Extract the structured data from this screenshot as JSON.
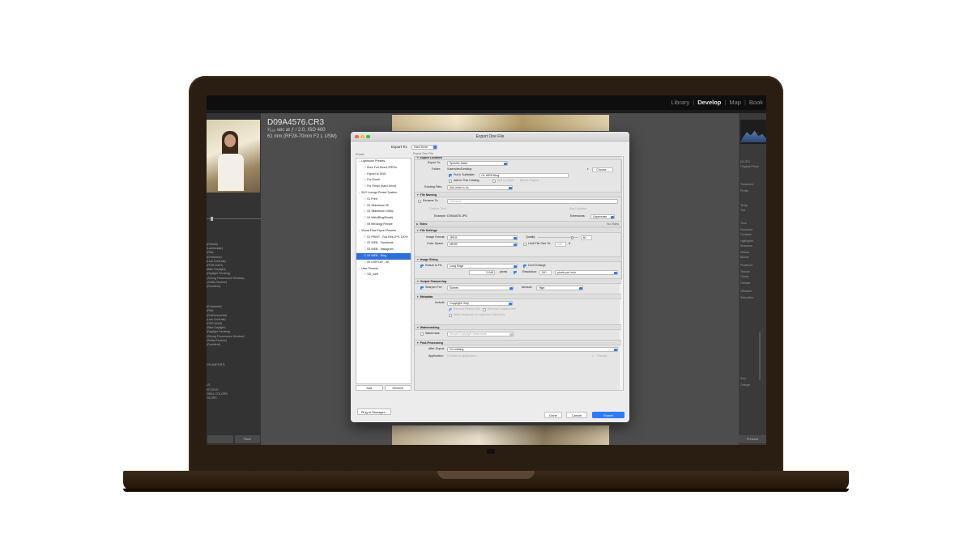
{
  "lightroom": {
    "modules": [
      "Library",
      "Develop",
      "Map",
      "Book"
    ],
    "active_module": "Develop",
    "image_info": {
      "filename": "D09A4576.CR3",
      "exposure": "¹⁄₃₂₀ sec at ƒ / 2.0, ISO 400",
      "lens": "61 mm (RF28-70mm F2 L USM)"
    },
    "left_footer": [
      "",
      "Paste"
    ],
    "right_footer": "Previous",
    "right_panel_texts": [
      "D0 ISO",
      "Original Photo",
      "Treatment",
      "Profile",
      "Temp",
      "Tint",
      "Tone",
      "Exposure",
      "Contrast",
      "Highlights",
      "Shadows",
      "Whites",
      "Blacks",
      "Presence",
      "Texture",
      "Clarity",
      "Dehaze",
      "Vibrance",
      "Saturation",
      "Red",
      "Orange"
    ],
    "left_panel_items": [
      "(Default)",
      "(Landscape)",
      "(Flat)",
      "(Enhanced)",
      "(Low Contrast)",
      "(FISH 400H)",
      "(Blue Daylight)",
      "(Daylight Sensing)",
      "(Strong Fluorescent Window)",
      "(Softis Restore)",
      "(Excellent)",
      "",
      "(Enhanced)",
      "(Flat)",
      "(Environmental)",
      "(Low Contrast)",
      "(DFR 400H)",
      "(Blue Daylight)",
      "(Daylight Sensing)",
      "(Strong Fluorescent Window)",
      "(Softis Restore)",
      "(Excellent)",
      "",
      "OS (IMPORT)",
      "",
      "LS",
      "ISTUDIO",
      "ORAL COLORS",
      "OLORS"
    ]
  },
  "dialog": {
    "title": "Export One File",
    "export_to_label": "Export To:",
    "export_to_value": "Hard Drive",
    "export_one_file": "Export One File",
    "preset_label": "Preset:",
    "presets": [
      {
        "type": "folder",
        "label": "Lightroom Presets"
      },
      {
        "type": "item",
        "label": "Burn Full-Sized JPEGs"
      },
      {
        "type": "item",
        "label": "Export to DNG"
      },
      {
        "type": "item",
        "label": "For Email"
      },
      {
        "type": "item",
        "label": "For Email (Hard Drive)"
      },
      {
        "type": "folder",
        "label": "SLR Lounge Preset System"
      },
      {
        "type": "item",
        "label": "01 Print"
      },
      {
        "type": "item",
        "label": "02 Slideshow 4K"
      },
      {
        "type": "item",
        "label": "03 Slideshow 1080p"
      },
      {
        "type": "item",
        "label": "04 Web(Blog/Email)"
      },
      {
        "type": "item",
        "label": "05 Mixology Recipe"
      },
      {
        "type": "folder",
        "label": "Visual Flow Export Presets"
      },
      {
        "type": "item",
        "label": "01 PRINT - Full-Res JPG 100%"
      },
      {
        "type": "item",
        "label": "02 WEB - Facebook"
      },
      {
        "type": "item",
        "label": "03 WEB - Instagram"
      },
      {
        "type": "item",
        "label": "04 WEB - Blog",
        "selected": true
      },
      {
        "type": "item",
        "label": "05 DISPLAY - 4K"
      },
      {
        "type": "folder",
        "label": "User Presets"
      },
      {
        "type": "item",
        "label": "SD_web"
      }
    ],
    "add_button": "Add",
    "remove_button": "Remove",
    "plugin_manager_button": "Plug-in Manager...",
    "done_button": "Done",
    "cancel_button": "Cancel",
    "export_button": "Export",
    "location": {
      "header": "Export Location",
      "export_to_label": "Export To:",
      "export_to_value": "Specific folder",
      "folder_label": "Folder:",
      "folder_value": "/Users/dm/Desktop",
      "choose_button": "Choose...",
      "subfolder_label": "Put in Subfolder:",
      "subfolder_value": "04-WEB-Blog",
      "add_catalog_label": "Add to This Catalog",
      "add_stack_label": "Add to Stack:",
      "add_stack_value": "Below Original",
      "existing_files_label": "Existing Files:",
      "existing_files_value": "Ask what to do"
    },
    "naming": {
      "header": "File Naming",
      "rename_label": "Rename To:",
      "rename_value": "Filename",
      "custom_text_label": "Custom Text:",
      "start_number_label": "Start Number:",
      "example_label": "Example:",
      "example_value": "D09A4576.JPG",
      "extensions_label": "Extensions:",
      "extensions_value": "Uppercase"
    },
    "video": {
      "header": "Video",
      "note": "No Video"
    },
    "file_settings": {
      "header": "File Settings",
      "format_label": "Image Format:",
      "format_value": "JPEG",
      "quality_label": "Quality:",
      "quality_value": "80",
      "color_space_label": "Color Space:",
      "color_space_value": "sRGB",
      "limit_label": "Limit File Size To:",
      "limit_value": "100",
      "limit_unit": "K"
    },
    "sizing": {
      "header": "Image Sizing",
      "resize_label": "Resize to Fit:",
      "resize_value": "Long Edge",
      "dont_enlarge_label": "Don't Enlarge",
      "size_value": "2,048",
      "size_unit": "pixels",
      "resolution_label": "Resolution:",
      "resolution_value": "240",
      "resolution_unit": "pixels per inch"
    },
    "sharpening": {
      "header": "Output Sharpening",
      "sharpen_label": "Sharpen For:",
      "sharpen_value": "Screen",
      "amount_label": "Amount:",
      "amount_value": "High"
    },
    "metadata": {
      "header": "Metadata",
      "include_label": "Include:",
      "include_value": "Copyright Only",
      "remove_person_label": "Remove Person Info",
      "remove_location_label": "Remove Location Info",
      "hierarchy_label": "Write Keywords as Lightroom Hierarchy"
    },
    "watermark": {
      "header": "Watermarking",
      "label": "Watermark:",
      "value": "Simple Copyright Watermark"
    },
    "post": {
      "header": "Post-Processing",
      "after_label": "After Export:",
      "after_value": "Do nothing",
      "app_label": "Application:",
      "app_placeholder": "Choose an application...",
      "choose_button": "Choose..."
    }
  },
  "colors": {
    "laptop_bezel": "#2a1e12",
    "accent_blue": "#2f7bf6",
    "selected_row": "#2f6fd9"
  }
}
